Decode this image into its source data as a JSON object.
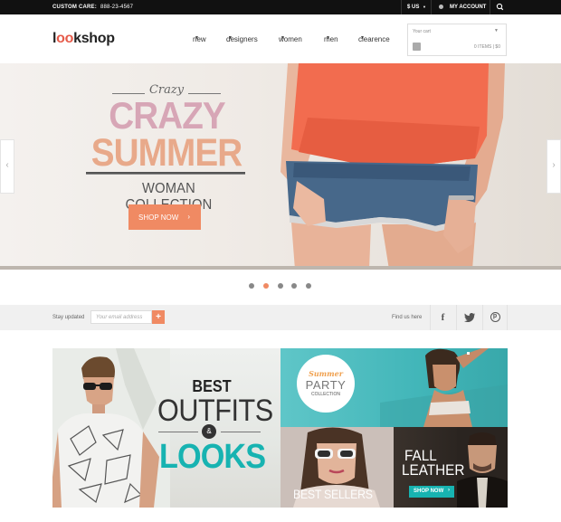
{
  "topbar": {
    "care_label": "CUSTOM CARE:",
    "care_phone": "888-23-4567",
    "currency": "$ US",
    "account": "MY ACCOUNT"
  },
  "header": {
    "logo_prefix": "l",
    "logo_oo": "oo",
    "logo_suffix": "kshop",
    "nav": [
      "new",
      "designers",
      "women",
      "men",
      "clearence"
    ],
    "cart": {
      "label": "Your cart",
      "items": "0 ITEMS  |  $0"
    }
  },
  "hero": {
    "script": "Crazy",
    "headline_1": "CRAZY",
    "headline_2": "SUMMER",
    "subtitle": "WOMAN COLLECTION",
    "cta": "SHOP NOW"
  },
  "slider": {
    "slide_count": 5,
    "active_index": 1
  },
  "newsletter": {
    "label": "Stay updated",
    "placeholder": "Your email address",
    "find_us": "Find us here"
  },
  "promos": {
    "best": {
      "line1": "BEST",
      "line2": "OUTFITS",
      "amp": "&",
      "line3": "LOOKS"
    },
    "summer": {
      "script": "Summer",
      "word": "PARTY",
      "small": "COLLECTION"
    },
    "sellers": {
      "label": "BEST SELLERS"
    },
    "leather": {
      "line1": "FALL",
      "line2": "LEATHER",
      "cta": "SHOP NOW"
    }
  },
  "colors": {
    "accent_orange": "#f08a63",
    "accent_teal": "#17b3b1",
    "topbar_bg": "#111111"
  }
}
